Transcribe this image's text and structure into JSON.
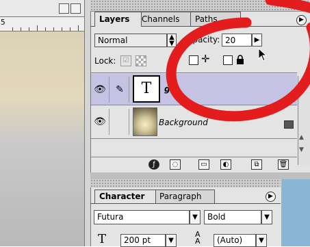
{
  "document": {
    "ruler_number": "5"
  },
  "layers_panel": {
    "tabs": [
      {
        "label": "Layers",
        "active": true
      },
      {
        "label": "Channels",
        "active": false
      },
      {
        "label": "Paths",
        "active": false
      }
    ],
    "blend_mode": "Normal",
    "opacity_label": "Opacity:",
    "opacity_value": "20",
    "lock_label": "Lock:",
    "layers": [
      {
        "name": "gk",
        "type": "text",
        "thumb_glyph": "T",
        "selected": true
      },
      {
        "name": "Background",
        "type": "image",
        "selected": false
      }
    ]
  },
  "character_panel": {
    "tabs": [
      {
        "label": "Character",
        "active": true
      },
      {
        "label": "Paragraph",
        "active": false
      }
    ],
    "font_family": "Futura",
    "font_style": "Bold",
    "font_size": "200 pt",
    "leading": "(Auto)"
  },
  "colors": {
    "selected_row": "#c4c3e4",
    "annotation_red": "#e31d1d",
    "panel_bg": "#e4e4e4"
  },
  "icons": [
    "eye-icon",
    "brush-icon",
    "lock-icon",
    "move-icon",
    "trash-icon",
    "new-layer-icon",
    "folder-icon",
    "mask-icon",
    "adjustment-icon",
    "style-icon",
    "arrow-cursor-icon"
  ]
}
